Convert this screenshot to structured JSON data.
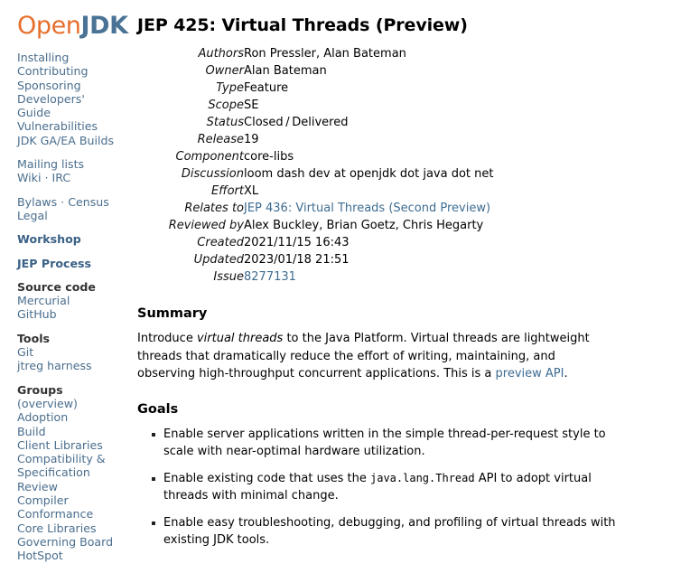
{
  "site": {
    "logo_open": "Open",
    "logo_jdk": "JDK"
  },
  "sidebar": {
    "groups": [
      {
        "items": [
          {
            "label": "Installing",
            "type": "link"
          },
          {
            "label": "Contributing",
            "type": "link"
          },
          {
            "label": "Sponsoring",
            "type": "link"
          },
          {
            "label": "Developers' Guide",
            "type": "link-wrap"
          },
          {
            "label": "Vulnerabilities",
            "type": "link"
          },
          {
            "label": "JDK GA/EA Builds",
            "type": "link"
          }
        ]
      },
      {
        "items": [
          {
            "label": "Mailing lists",
            "type": "link"
          },
          {
            "label": "Wiki",
            "type": "link-inline",
            "sep": "·",
            "label2": "IRC"
          }
        ]
      },
      {
        "items": [
          {
            "label": "Bylaws",
            "type": "link-inline",
            "sep": "·",
            "label2": "Census"
          },
          {
            "label": "Legal",
            "type": "link"
          }
        ]
      },
      {
        "items": [
          {
            "label": "Workshop",
            "type": "link-bold"
          }
        ]
      },
      {
        "items": [
          {
            "label": "JEP Process",
            "type": "link-bold"
          }
        ]
      },
      {
        "heading": "Source code",
        "items": [
          {
            "label": "Mercurial",
            "type": "link"
          },
          {
            "label": "GitHub",
            "type": "link"
          }
        ]
      },
      {
        "heading": "Tools",
        "items": [
          {
            "label": "Git",
            "type": "link"
          },
          {
            "label": "jtreg harness",
            "type": "link"
          }
        ]
      },
      {
        "heading": "Groups",
        "items": [
          {
            "label": "(overview)",
            "type": "link"
          },
          {
            "label": "Adoption",
            "type": "link"
          },
          {
            "label": "Build",
            "type": "link"
          },
          {
            "label": "Client Libraries",
            "type": "link"
          },
          {
            "label": "Compatibility & Specification Review",
            "type": "link-wrap"
          },
          {
            "label": "Compiler",
            "type": "link"
          },
          {
            "label": "Conformance",
            "type": "link"
          },
          {
            "label": "Core Libraries",
            "type": "link"
          },
          {
            "label": "Governing Board",
            "type": "link"
          },
          {
            "label": "HotSpot",
            "type": "link"
          }
        ]
      }
    ]
  },
  "jep": {
    "title": "JEP 425: Virtual Threads (Preview)",
    "meta": [
      {
        "label": "Authors",
        "value": "Ron Pressler, Alan Bateman",
        "link": false
      },
      {
        "label": "Owner",
        "value": "Alan Bateman",
        "link": false
      },
      {
        "label": "Type",
        "value": "Feature",
        "link": false
      },
      {
        "label": "Scope",
        "value": "SE",
        "link": false
      },
      {
        "label": "Status",
        "value": "Closed / Delivered",
        "link": false
      },
      {
        "label": "Release",
        "value": "19",
        "link": false
      },
      {
        "label": "Component",
        "value": "core-libs",
        "link": false
      },
      {
        "label": "Discussion",
        "value": "loom dash dev at openjdk dot java dot net",
        "link": false
      },
      {
        "label": "Effort",
        "value": "XL",
        "link": false
      },
      {
        "label": "Relates to",
        "value": "JEP 436: Virtual Threads (Second Preview)",
        "link": true
      },
      {
        "label": "Reviewed by",
        "value": "Alex Buckley, Brian Goetz, Chris Hegarty",
        "link": false
      },
      {
        "label": "Created",
        "value": "2021/11/15 16:43",
        "link": false
      },
      {
        "label": "Updated",
        "value": "2023/01/18 21:51",
        "link": false
      },
      {
        "label": "Issue",
        "value": "8277131",
        "link": true
      }
    ],
    "summary_heading": "Summary",
    "summary": {
      "part1": "Introduce ",
      "emphasis": "virtual threads",
      "part2": " to the Java Platform. Virtual threads are lightweight threads that dramatically reduce the effort of writing, maintaining, and observing high-throughput concurrent applications. This is a ",
      "link": "preview API",
      "part3": "."
    },
    "goals_heading": "Goals",
    "goals": [
      {
        "part1": "Enable server applications written in the simple thread-per-request style to scale with near-optimal hardware utilization.",
        "code": "",
        "part2": ""
      },
      {
        "part1": "Enable existing code that uses the ",
        "code": "java.lang.Thread",
        "part2": " API to adopt virtual threads with minimal change."
      },
      {
        "part1": "Enable easy troubleshooting, debugging, and profiling of virtual threads with existing JDK tools.",
        "code": "",
        "part2": ""
      }
    ]
  },
  "colors": {
    "logo_orange": "#e76f2c",
    "logo_blue": "#4a7396",
    "link_blue": "#4a6e8e",
    "content_link_blue": "#3d6c92",
    "heading_dark": "#333333",
    "background": "#ffffff"
  }
}
